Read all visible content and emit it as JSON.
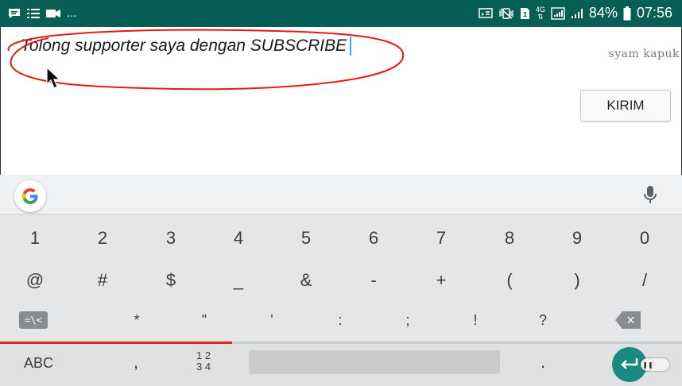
{
  "status_bar": {
    "left_more": "...",
    "battery": "84%",
    "time": "07:56",
    "network": "4G"
  },
  "compose": {
    "message": "Tolong supporter saya dengan SUBSCRIBE",
    "send_label": "KIRIM",
    "watermark": "syam kapuk"
  },
  "keyboard": {
    "row1": [
      "1",
      "2",
      "3",
      "4",
      "5",
      "6",
      "7",
      "8",
      "9",
      "0"
    ],
    "row2": [
      "@",
      "#",
      "$",
      "_",
      "&",
      "-",
      "+",
      "(",
      ")",
      "/"
    ],
    "row3": {
      "symbols_key": "=\\<",
      "keys": [
        "*",
        "\"",
        "'",
        ":",
        ";",
        "!",
        "?"
      ]
    },
    "bottom": {
      "abc": "ABC",
      "comma": ",",
      "numpad_top": "1 2",
      "numpad_bottom": "3 4",
      "period": "."
    }
  },
  "video": {
    "progress_percent": 34
  },
  "colors": {
    "status_bar": "#075e54",
    "highlight_circle": "#e31b1b",
    "progress": "#e62117",
    "enter_key": "#1a8a80",
    "cursor": "#4aa3d9"
  }
}
